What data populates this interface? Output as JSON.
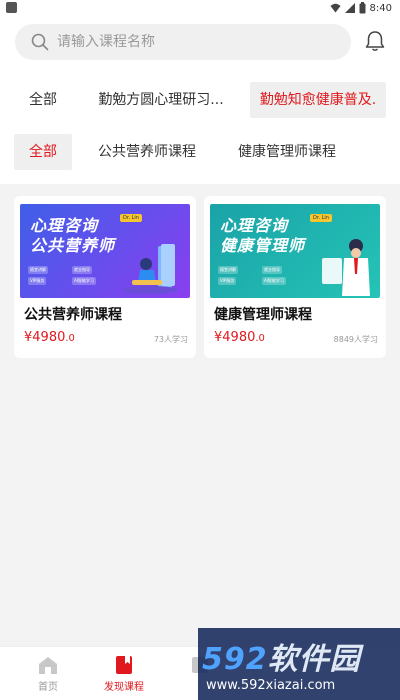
{
  "status_bar": {
    "time": "8:40"
  },
  "search": {
    "placeholder": "请输入课程名称"
  },
  "categories_row1": [
    {
      "label": "全部",
      "active": false
    },
    {
      "label": "勤勉方圆心理研习...",
      "active": false
    },
    {
      "label": "勤勉知愈健康普及.",
      "active": true
    }
  ],
  "categories_row2": [
    {
      "label": "全部",
      "active": true
    },
    {
      "label": "公共营养师课程",
      "active": false
    },
    {
      "label": "健康管理师课程",
      "active": false
    }
  ],
  "courses": [
    {
      "title": "公共营养师课程",
      "price_main": "¥4980",
      "price_decimal": ".0",
      "learners": "73人学习",
      "thumb_line1": "心理咨询",
      "thumb_line2": "公共营养师",
      "thumb_badge": "Dr. Lin",
      "thumb_bg_start": "#3f5fe8",
      "thumb_bg_end": "#8a3ff0",
      "thumb_tags": [
        "随堂讲解",
        "就业指导",
        "VIP服务",
        "AI智能学习"
      ]
    },
    {
      "title": "健康管理师课程",
      "price_main": "¥4980",
      "price_decimal": ".0",
      "learners": "8849人学习",
      "thumb_line1": "心理咨询",
      "thumb_line2": "健康管理师",
      "thumb_badge": "Dr. Lin",
      "thumb_bg_start": "#1aa3a8",
      "thumb_bg_end": "#25c3b6",
      "thumb_tags": [
        "随堂讲解",
        "就业指导",
        "VIP服务",
        "AI智能学习"
      ]
    }
  ],
  "bottom_nav": [
    {
      "label": "首页",
      "icon": "home-icon",
      "active": false
    },
    {
      "label": "发现课程",
      "icon": "bookmark-book-icon",
      "active": true
    },
    {
      "label": "",
      "icon": "grid-icon",
      "active": false
    }
  ],
  "watermark": {
    "logo_num": "592",
    "logo_text": "软件园",
    "url": "www.592xiazai.com"
  },
  "colors": {
    "accent": "#e0191e",
    "page_bg": "#f3f3f3",
    "chip_bg": "#efefef"
  }
}
